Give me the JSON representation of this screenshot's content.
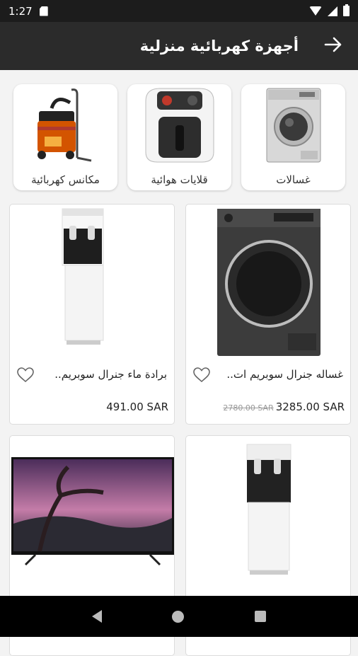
{
  "status_bar": {
    "time": "1:27"
  },
  "header": {
    "title": "أجهزة كهربائية منزلية"
  },
  "categories": [
    {
      "label": "غسالات",
      "icon": "washing-machine"
    },
    {
      "label": "قلايات هوائية",
      "icon": "air-fryer"
    },
    {
      "label": "مكانس كهربائية",
      "icon": "vacuum-cleaner"
    }
  ],
  "products": [
    {
      "name": "غساله جنرال سوبريم ات..",
      "price": "3285.00 SAR",
      "old_price": "2780.00 SAR",
      "icon": "washing-machine"
    },
    {
      "name": "برادة ماء جنرال سوبريم..",
      "price": "491.00 SAR",
      "old_price": "",
      "icon": "water-dispenser"
    },
    {
      "name": "",
      "price": "",
      "old_price": "",
      "icon": "water-dispenser"
    },
    {
      "name": "",
      "price": "",
      "old_price": "",
      "icon": "television"
    }
  ],
  "colors": {
    "header_bg": "#2b2b2b",
    "status_bg": "#1c1c1c",
    "page_bg": "#f3f3f3"
  }
}
